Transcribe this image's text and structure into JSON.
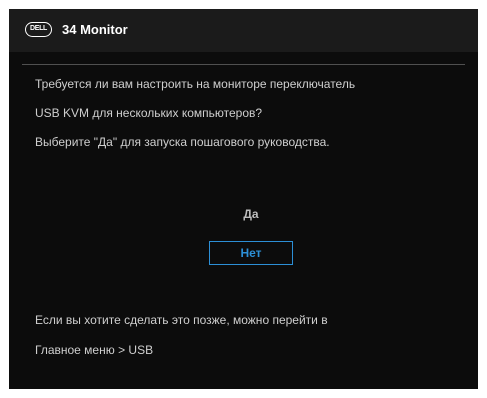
{
  "header": {
    "logo_text": "DELL",
    "title": "34 Monitor"
  },
  "message": {
    "line1": "Требуется ли вам настроить на мониторе переключатель",
    "line2": "USB KVM для нескольких компьютеров?",
    "line3": "Выберите \"Да\" для запуска пошагового руководства."
  },
  "options": {
    "yes_label": "Да",
    "no_label": "Нет",
    "selected": "Нет"
  },
  "footer": {
    "line1": "Если вы хотите сделать это позже, можно перейти в",
    "line2": "Главное меню > USB"
  },
  "colors": {
    "background": "#0c0c0c",
    "titlebar": "#1b1b1b",
    "accent": "#2c8fd6",
    "text": "#cfcfcf"
  }
}
